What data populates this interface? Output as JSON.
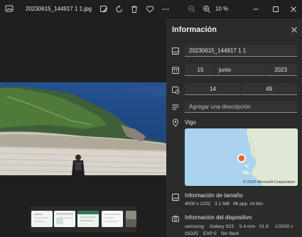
{
  "toolbar": {
    "file_name": "20230615_144917 1 1.jpg",
    "zoom_level": "10 %",
    "icons": [
      "edit-image-icon",
      "rotate-icon",
      "delete-icon",
      "favorite-icon",
      "more-icon",
      "zoom-out-icon",
      "zoom-in-icon"
    ]
  },
  "window": {
    "controls": [
      "minimize",
      "maximize",
      "close"
    ]
  },
  "filmstrip": {
    "thumbnails": [
      "thumb-1",
      "thumb-2",
      "thumb-3",
      "thumb-4",
      "thumb-5"
    ]
  },
  "info_panel": {
    "title": "Información",
    "name": "20230615_144917 1 1",
    "date": {
      "day": "15",
      "month": "junio",
      "year": "2023"
    },
    "time": {
      "hour": "14",
      "minute": "49"
    },
    "description_placeholder": "Agregar una descripción",
    "location_label": "Vigo",
    "map_copyright": "© 2023 Microsoft Corporation",
    "size_section": {
      "title": "Información de tamaño",
      "dimensions": "4000 x 2252",
      "file_size": "3.1 MB",
      "resolution": "96 ppp",
      "bit_depth": "24 bits"
    },
    "device_section": {
      "title": "Información del dispositivo",
      "make": "samsung",
      "model": "Galaxy S23",
      "focal_length": "5.4 mm",
      "aperture": "f/1.8",
      "shutter": "1/3200 s",
      "iso": "ISO25",
      "exposure": "EXP 0",
      "flash": "Sin flash"
    }
  },
  "colors": {
    "panel_bg": "#2b2b2b",
    "viewer_bg": "#1f1f1f",
    "map_pin": "#e8622c"
  }
}
